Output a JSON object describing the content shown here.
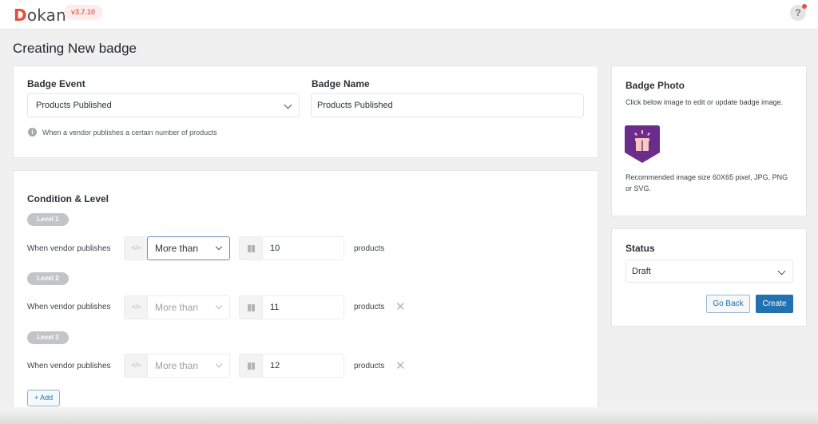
{
  "header": {
    "logo_first": "D",
    "logo_rest": "okan",
    "version": "v3.7.10",
    "help_label": "?"
  },
  "page": {
    "title": "Creating New badge"
  },
  "badge_info": {
    "event_label": "Badge Event",
    "event_value": "Products Published",
    "name_label": "Badge Name",
    "name_value": "Products Published",
    "hint": "When a vendor publishes a certain number of products",
    "info_glyph": "i"
  },
  "conditions": {
    "title": "Condition & Level",
    "code_glyph": "</>",
    "levels": [
      {
        "label": "Level 1",
        "prefix": "When vendor publishes",
        "operator": "More than",
        "value": "10",
        "suffix": "products",
        "removable": false
      },
      {
        "label": "Level 2",
        "prefix": "When vendor publishes",
        "operator": "More than",
        "value": "11",
        "suffix": "products",
        "removable": true
      },
      {
        "label": "Level 3",
        "prefix": "When vendor publishes",
        "operator": "More than",
        "value": "12",
        "suffix": "products",
        "removable": true
      }
    ],
    "remove_glyph": "✕",
    "add_label": "+ Add"
  },
  "badge_photo": {
    "title": "Badge Photo",
    "instruction": "Click below image to edit or update badge image.",
    "recommendation": "Recommended image size 60X65 pixel, JPG, PNG or SVG.",
    "badge_color": "#6b2d8c",
    "icon_color": "#fbc7bf"
  },
  "status": {
    "title": "Status",
    "value": "Draft",
    "back_label": "Go Back",
    "create_label": "Create"
  }
}
